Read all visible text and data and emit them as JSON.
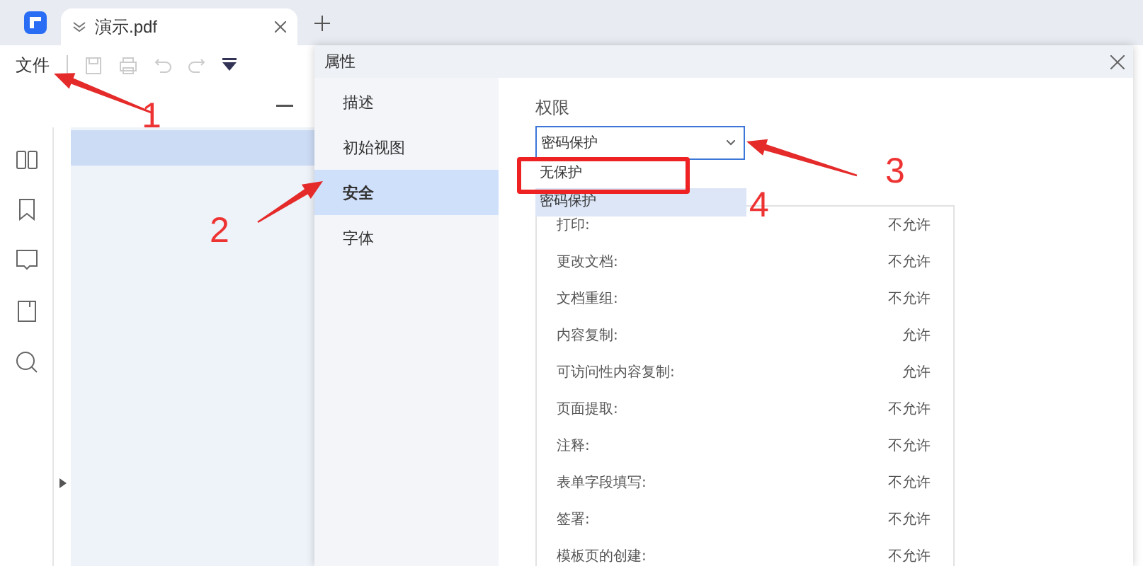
{
  "tab_bar": {
    "tabs": [
      {
        "title": "演示.pdf",
        "selected": true
      }
    ]
  },
  "toolbar": {
    "file_menu": "文件"
  },
  "dialog": {
    "title": "属性",
    "nav": [
      {
        "label": "描述",
        "selected": false
      },
      {
        "label": "初始视图",
        "selected": false
      },
      {
        "label": "安全",
        "selected": true
      },
      {
        "label": "字体",
        "selected": false
      }
    ],
    "permissions": {
      "label": "权限",
      "select_value": "密码保护",
      "dropdown": [
        {
          "label": "无保护",
          "selected": false,
          "annotated": true
        },
        {
          "label": "密码保护",
          "selected": true,
          "annotated": false
        }
      ],
      "rows": [
        {
          "name": "打印:",
          "value": "不允许"
        },
        {
          "name": "更改文档:",
          "value": "不允许"
        },
        {
          "name": "文档重组:",
          "value": "不允许"
        },
        {
          "name": "内容复制:",
          "value": "允许"
        },
        {
          "name": "可访问性内容复制:",
          "value": "允许"
        },
        {
          "name": "页面提取:",
          "value": "不允许"
        },
        {
          "name": "注释:",
          "value": "不允许"
        },
        {
          "name": "表单字段填写:",
          "value": "不允许"
        },
        {
          "name": "签署:",
          "value": "不允许"
        },
        {
          "name": "模板页的创建:",
          "value": "不允许"
        }
      ]
    }
  },
  "annotations": [
    {
      "number": "1"
    },
    {
      "number": "2"
    },
    {
      "number": "3"
    },
    {
      "number": "4"
    }
  ]
}
